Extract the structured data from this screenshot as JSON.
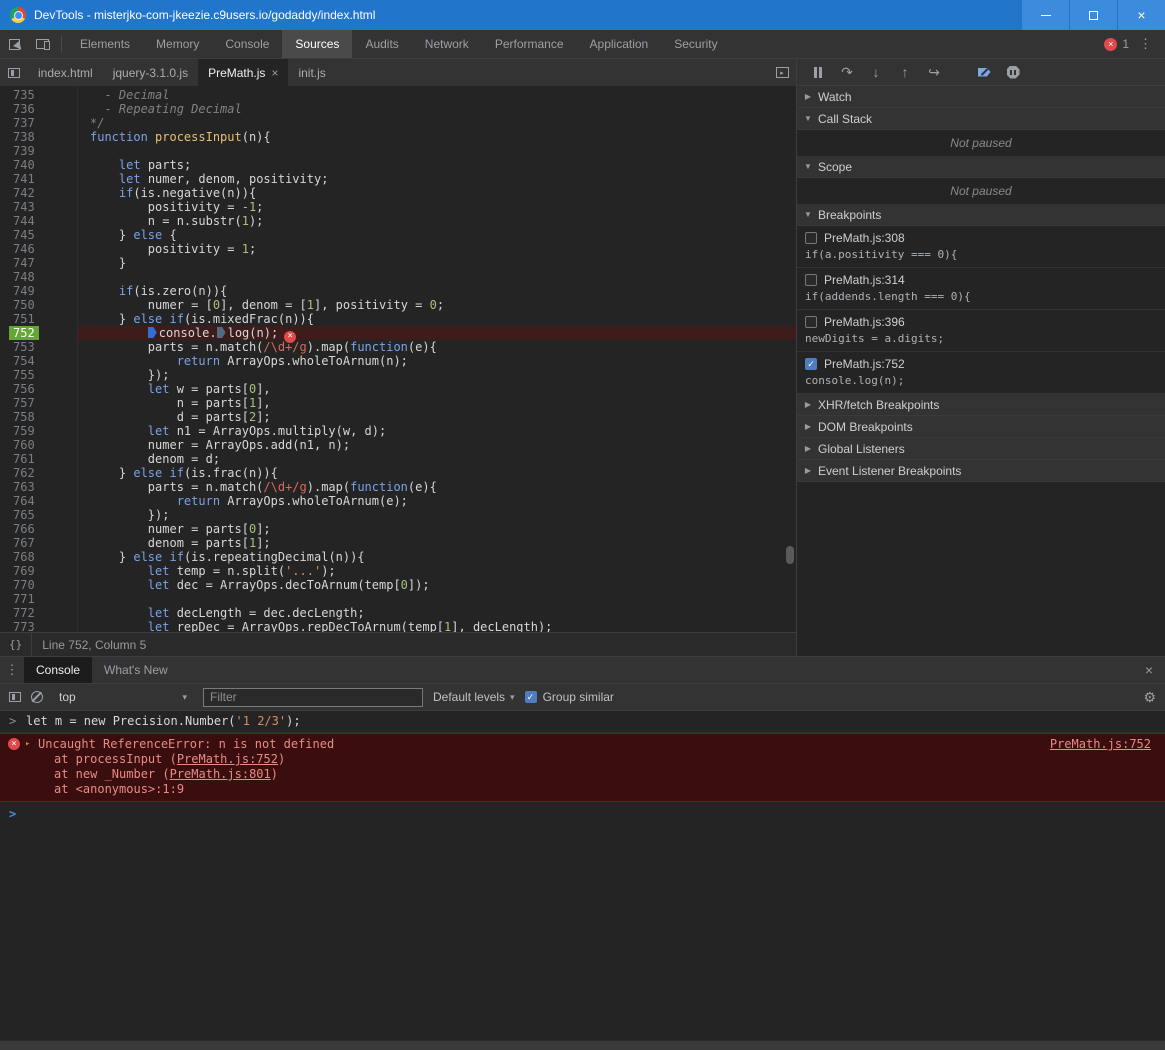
{
  "colors": {
    "titlebar_blue": "#2176cb",
    "error_red": "#e04a4a",
    "breakpoint_blue": "#2f6fd6",
    "current_line_green": "#62a832",
    "error_line_bg": "#3e1c1c",
    "console_error_bg": "#3a0e0e",
    "checkbox_blue": "#4f7dbf"
  },
  "window": {
    "title": "DevTools - misterjko-com-jkeezie.c9users.io/godaddy/index.html"
  },
  "main_toolbar": {
    "tabs": [
      "Elements",
      "Memory",
      "Console",
      "Sources",
      "Audits",
      "Network",
      "Performance",
      "Application",
      "Security"
    ],
    "active_tab": "Sources",
    "error_count": "1"
  },
  "file_tabs": {
    "items": [
      "index.html",
      "jquery-3.1.0.js",
      "PreMath.js",
      "init.js"
    ],
    "active": "PreMath.js",
    "close_glyph": "×"
  },
  "editor": {
    "status_line": "Line 752, Column 5",
    "pretty_print_label": "{}",
    "lines": [
      {
        "n": 735,
        "s": [
          [
            "cm",
            "  - Decimal"
          ]
        ]
      },
      {
        "n": 736,
        "s": [
          [
            "cm",
            "  - Repeating Decimal"
          ]
        ]
      },
      {
        "n": 737,
        "s": [
          [
            "cm",
            "*/"
          ]
        ]
      },
      {
        "n": 738,
        "s": [
          [
            "kw",
            "function"
          ],
          [
            "pl",
            " "
          ],
          [
            "fn",
            "processInput"
          ],
          [
            "pl",
            "(n){"
          ]
        ]
      },
      {
        "n": 739,
        "s": []
      },
      {
        "n": 740,
        "s": [
          [
            "pl",
            "    "
          ],
          [
            "kw",
            "let"
          ],
          [
            "pl",
            " parts;"
          ]
        ]
      },
      {
        "n": 741,
        "s": [
          [
            "pl",
            "    "
          ],
          [
            "kw",
            "let"
          ],
          [
            "pl",
            " numer, denom, positivity;"
          ]
        ]
      },
      {
        "n": 742,
        "s": [
          [
            "pl",
            "    "
          ],
          [
            "kw",
            "if"
          ],
          [
            "pl",
            "(is.negative(n)){"
          ]
        ]
      },
      {
        "n": 743,
        "s": [
          [
            "pl",
            "        positivity = "
          ],
          [
            "nu",
            "-1"
          ],
          [
            "pl",
            ";"
          ]
        ]
      },
      {
        "n": 744,
        "s": [
          [
            "pl",
            "        n = n.substr("
          ],
          [
            "nu",
            "1"
          ],
          [
            "pl",
            ");"
          ]
        ]
      },
      {
        "n": 745,
        "s": [
          [
            "pl",
            "    } "
          ],
          [
            "kw",
            "else"
          ],
          [
            "pl",
            " {"
          ]
        ]
      },
      {
        "n": 746,
        "s": [
          [
            "pl",
            "        positivity = "
          ],
          [
            "nu",
            "1"
          ],
          [
            "pl",
            ";"
          ]
        ]
      },
      {
        "n": 747,
        "s": [
          [
            "pl",
            "    }"
          ]
        ]
      },
      {
        "n": 748,
        "s": []
      },
      {
        "n": 749,
        "s": [
          [
            "pl",
            "    "
          ],
          [
            "kw",
            "if"
          ],
          [
            "pl",
            "(is.zero(n)){"
          ]
        ]
      },
      {
        "n": 750,
        "s": [
          [
            "pl",
            "        numer = ["
          ],
          [
            "nu",
            "0"
          ],
          [
            "pl",
            "], denom = ["
          ],
          [
            "nu",
            "1"
          ],
          [
            "pl",
            "], positivity = "
          ],
          [
            "nu",
            "0"
          ],
          [
            "pl",
            ";"
          ]
        ]
      },
      {
        "n": 751,
        "s": [
          [
            "pl",
            "    } "
          ],
          [
            "kw",
            "else"
          ],
          [
            "pl",
            " "
          ],
          [
            "kw",
            "if"
          ],
          [
            "pl",
            "(is.mixedFrac(n)){"
          ]
        ]
      },
      {
        "n": 752,
        "cur": true,
        "s": [
          [
            "pl",
            "        "
          ],
          [
            "mk",
            ""
          ],
          [
            "pl",
            "console."
          ],
          [
            "mk2",
            ""
          ],
          [
            "pl",
            "log(n);"
          ],
          [
            "er",
            "×"
          ]
        ]
      },
      {
        "n": 753,
        "s": [
          [
            "pl",
            "        parts = n.match("
          ],
          [
            "re",
            "/\\d+/g"
          ],
          [
            "pl",
            ").map("
          ],
          [
            "kw",
            "function"
          ],
          [
            "pl",
            "(e){"
          ]
        ]
      },
      {
        "n": 754,
        "s": [
          [
            "pl",
            "            "
          ],
          [
            "kw",
            "return"
          ],
          [
            "pl",
            " ArrayOps.wholeToArnum(n);"
          ]
        ]
      },
      {
        "n": 755,
        "s": [
          [
            "pl",
            "        });"
          ]
        ]
      },
      {
        "n": 756,
        "s": [
          [
            "pl",
            "        "
          ],
          [
            "kw",
            "let"
          ],
          [
            "pl",
            " w = parts["
          ],
          [
            "nu",
            "0"
          ],
          [
            "pl",
            "],"
          ]
        ]
      },
      {
        "n": 757,
        "s": [
          [
            "pl",
            "            n = parts["
          ],
          [
            "nu",
            "1"
          ],
          [
            "pl",
            "],"
          ]
        ]
      },
      {
        "n": 758,
        "s": [
          [
            "pl",
            "            d = parts["
          ],
          [
            "nu",
            "2"
          ],
          [
            "pl",
            "];"
          ]
        ]
      },
      {
        "n": 759,
        "s": [
          [
            "pl",
            "        "
          ],
          [
            "kw",
            "let"
          ],
          [
            "pl",
            " n1 = ArrayOps.multiply(w, d);"
          ]
        ]
      },
      {
        "n": 760,
        "s": [
          [
            "pl",
            "        numer = ArrayOps.add(n1, n);"
          ]
        ]
      },
      {
        "n": 761,
        "s": [
          [
            "pl",
            "        denom = d;"
          ]
        ]
      },
      {
        "n": 762,
        "s": [
          [
            "pl",
            "    } "
          ],
          [
            "kw",
            "else"
          ],
          [
            "pl",
            " "
          ],
          [
            "kw",
            "if"
          ],
          [
            "pl",
            "(is.frac(n)){"
          ]
        ]
      },
      {
        "n": 763,
        "s": [
          [
            "pl",
            "        parts = n.match("
          ],
          [
            "re",
            "/\\d+/g"
          ],
          [
            "pl",
            ").map("
          ],
          [
            "kw",
            "function"
          ],
          [
            "pl",
            "(e){"
          ]
        ]
      },
      {
        "n": 764,
        "s": [
          [
            "pl",
            "            "
          ],
          [
            "kw",
            "return"
          ],
          [
            "pl",
            " ArrayOps.wholeToArnum(e);"
          ]
        ]
      },
      {
        "n": 765,
        "s": [
          [
            "pl",
            "        });"
          ]
        ]
      },
      {
        "n": 766,
        "s": [
          [
            "pl",
            "        numer = parts["
          ],
          [
            "nu",
            "0"
          ],
          [
            "pl",
            "];"
          ]
        ]
      },
      {
        "n": 767,
        "s": [
          [
            "pl",
            "        denom = parts["
          ],
          [
            "nu",
            "1"
          ],
          [
            "pl",
            "];"
          ]
        ]
      },
      {
        "n": 768,
        "s": [
          [
            "pl",
            "    } "
          ],
          [
            "kw",
            "else"
          ],
          [
            "pl",
            " "
          ],
          [
            "kw",
            "if"
          ],
          [
            "pl",
            "(is.repeatingDecimal(n)){"
          ]
        ]
      },
      {
        "n": 769,
        "s": [
          [
            "pl",
            "        "
          ],
          [
            "kw",
            "let"
          ],
          [
            "pl",
            " temp = n.split("
          ],
          [
            "st",
            "'...'"
          ],
          [
            "pl",
            ");"
          ]
        ]
      },
      {
        "n": 770,
        "s": [
          [
            "pl",
            "        "
          ],
          [
            "kw",
            "let"
          ],
          [
            "pl",
            " dec = ArrayOps.decToArnum(temp["
          ],
          [
            "nu",
            "0"
          ],
          [
            "pl",
            "]);"
          ]
        ]
      },
      {
        "n": 771,
        "s": []
      },
      {
        "n": 772,
        "s": [
          [
            "pl",
            "        "
          ],
          [
            "kw",
            "let"
          ],
          [
            "pl",
            " decLength = dec.decLength;"
          ]
        ]
      },
      {
        "n": 773,
        "s": [
          [
            "pl",
            "        "
          ],
          [
            "kw",
            "let"
          ],
          [
            "pl",
            " repDec = ArrayOps.repDecToArnum(temp["
          ],
          [
            "nu",
            "1"
          ],
          [
            "pl",
            "], decLength);"
          ]
        ]
      }
    ]
  },
  "debugger": {
    "watch": "Watch",
    "call_stack": "Call Stack",
    "scope": "Scope",
    "breakpoints_label": "Breakpoints",
    "not_paused": "Not paused",
    "xhr": "XHR/fetch Breakpoints",
    "dom": "DOM Breakpoints",
    "global_listeners": "Global Listeners",
    "event_listeners": "Event Listener Breakpoints",
    "breakpoints": [
      {
        "checked": false,
        "location": "PreMath.js:308",
        "code": "if(a.positivity === 0){"
      },
      {
        "checked": false,
        "location": "PreMath.js:314",
        "code": "if(addends.length === 0){"
      },
      {
        "checked": false,
        "location": "PreMath.js:396",
        "code": "newDigits = a.digits;"
      },
      {
        "checked": true,
        "location": "PreMath.js:752",
        "code": "console.log(n);"
      }
    ]
  },
  "console": {
    "tabs": [
      "Console",
      "What's New"
    ],
    "active_tab": "Console",
    "context": "top",
    "filter_placeholder": "Filter",
    "levels": "Default levels",
    "group_similar": "Group similar",
    "echo": {
      "prefix": "let m = new Precision.Number(",
      "string": "'1 2/3'",
      "suffix": ");"
    },
    "error": {
      "headline": "Uncaught ReferenceError: n is not defined",
      "source_link": "PreMath.js:752",
      "stack": [
        {
          "prefix": "at processInput (",
          "link": "PreMath.js:752",
          "suffix": ")"
        },
        {
          "prefix": "at new _Number (",
          "link": "PreMath.js:801",
          "suffix": ")"
        },
        {
          "prefix": "at <anonymous>:1:9",
          "link": "",
          "suffix": ""
        }
      ]
    }
  }
}
